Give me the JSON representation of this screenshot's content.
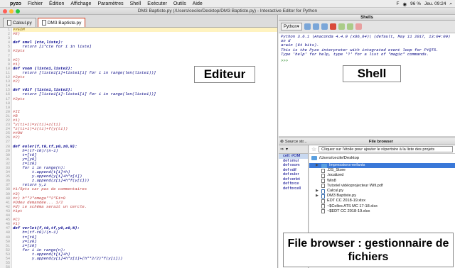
{
  "menubar": {
    "apple_icon": "apple-icon",
    "items": [
      "pyzo",
      "Fichier",
      "Édition",
      "Affichage",
      "Paramètres",
      "Shell",
      "Exécuter",
      "Outils",
      "Aide"
    ],
    "status": {
      "battery": "96 %",
      "datetime": "Jeu. 09:24",
      "keyboard": "F"
    }
  },
  "window": {
    "title": "DM3 Baptiste.py (/Users/cecile/Desktop/DM3 Baptiste.py) - Interactive Editor for Python",
    "colors": {
      "close": "#ff5f57",
      "minimize": "#febc2e",
      "zoom": "#28c840"
    }
  },
  "editor": {
    "tabs": [
      {
        "label": "Calcul.py",
        "active": false
      },
      {
        "label": "DM3 Baptiste.py",
        "active": true
      }
    ],
    "line_numbers": [
      "1",
      "2",
      "3",
      "4",
      "5",
      "6",
      "7",
      "8",
      "9",
      "10",
      "11",
      "12",
      "13",
      "14",
      "15",
      "16",
      "17",
      "18",
      "19",
      "20",
      "21",
      "22",
      "23",
      "24",
      "25",
      "26",
      "27",
      "28",
      "29",
      "30",
      "31",
      "32",
      "33",
      "34",
      "35",
      "36",
      "37",
      "38",
      "39",
      "40",
      "41",
      "42",
      "43",
      "44",
      "45",
      "46",
      "47",
      "48",
      "49",
      "50",
      "51",
      "52",
      "53",
      "54",
      "55",
      "56"
    ],
    "lines": [
      {
        "text": "##EDM",
        "kind": "cell"
      },
      {
        "text": "#E)",
        "kind": "cmt"
      },
      {
        "text": "",
        "kind": "code"
      },
      {
        "text": "def smul (cte,liste):",
        "kind": "def"
      },
      {
        "text": "    return [i*cte for i in liste]",
        "kind": "code"
      },
      {
        "text": "#2pts",
        "kind": "cmt"
      },
      {
        "text": "",
        "kind": "code"
      },
      {
        "text": "#C)",
        "kind": "cmt"
      },
      {
        "text": "#1)",
        "kind": "cmt"
      },
      {
        "text": "def vsom (liste1,liste2):",
        "kind": "def"
      },
      {
        "text": "    return [liste1[i]+liste1[i] for i in range(len(liste1))]",
        "kind": "code"
      },
      {
        "text": "#2pts",
        "kind": "cmt"
      },
      {
        "text": "#2)",
        "kind": "cmt"
      },
      {
        "text": "",
        "kind": "code"
      },
      {
        "text": "def vdif (liste1,liste2):",
        "kind": "def"
      },
      {
        "text": "    return [liste1[i]-liste1[i] for i in range(len(liste1))]",
        "kind": "code"
      },
      {
        "text": "#2pts",
        "kind": "cmt"
      },
      {
        "text": "",
        "kind": "code"
      },
      {
        "text": "",
        "kind": "code"
      },
      {
        "text": "#II",
        "kind": "cmt"
      },
      {
        "text": "#B",
        "kind": "cmt"
      },
      {
        "text": "#1)",
        "kind": "cmt"
      },
      {
        "text": "\"y(ti+1)=y(ti)+z(ti)",
        "kind": "cmt"
      },
      {
        "text": "\"z(ti+1)=z(ti)+f(y(ti))",
        "kind": "cmt"
      },
      {
        "text": "##ON",
        "kind": "cmt"
      },
      {
        "text": "#2)",
        "kind": "cmt"
      },
      {
        "text": "",
        "kind": "code"
      },
      {
        "text": "def euler(f,t0,tf,y0,z0,N):",
        "kind": "def"
      },
      {
        "text": "    h=(tf-t0)/(n-1)",
        "kind": "code"
      },
      {
        "text": "    t=[t0]",
        "kind": "code"
      },
      {
        "text": "    y=[y0]",
        "kind": "code"
      },
      {
        "text": "    z=[z0]",
        "kind": "code"
      },
      {
        "text": "    for i in range(n):",
        "kind": "code"
      },
      {
        "text": "        t.append(t[i]+h)",
        "kind": "code"
      },
      {
        "text": "        y.append(y[i]+h*z[i])",
        "kind": "code"
      },
      {
        "text": "        z.append(z[i]+h*f(y[i]))",
        "kind": "code"
      },
      {
        "text": "    return y,z",
        "kind": "code"
      },
      {
        "text": "#1/5pts car pas de commentaires",
        "kind": "cmt"
      },
      {
        "text": "#3)",
        "kind": "cmt"
      },
      {
        "text": "#c) h**2*omega**2*Ei=0",
        "kind": "cmt"
      },
      {
        "text": "#Odeu demandée... 1/2",
        "kind": "cmt"
      },
      {
        "text": "#d) Le schéma serait un cercle.",
        "kind": "cmt"
      },
      {
        "text": "#1pt",
        "kind": "cmt"
      },
      {
        "text": "",
        "kind": "code"
      },
      {
        "text": "#C)",
        "kind": "cmt"
      },
      {
        "text": "#1)",
        "kind": "cmt"
      },
      {
        "text": "def verlet(f,t0,tf,y0,z0,N):",
        "kind": "def"
      },
      {
        "text": "    h=(tf-t0)/(n-1)",
        "kind": "code"
      },
      {
        "text": "    t=[t0]",
        "kind": "code"
      },
      {
        "text": "    y=[y0]",
        "kind": "code"
      },
      {
        "text": "    z=[z0]",
        "kind": "code"
      },
      {
        "text": "    for i in range(n):",
        "kind": "code"
      },
      {
        "text": "        t.append(t[i]+h)",
        "kind": "code"
      },
      {
        "text": "        y.append(y[i]+h*z[i]+(h**2/2)*f(y[i]))",
        "kind": "code"
      },
      {
        "text": "",
        "kind": "code"
      },
      {
        "text": "",
        "kind": "code"
      }
    ],
    "overlay_label": "Editeur"
  },
  "shell": {
    "pane_title": "Shells",
    "tab_label": "Python",
    "output": [
      "Python 3.6.1 |Anaconda 4.4.0 (x86_64)| (default, May 11 2017, 13:04:09) on d",
      "arwin (64 bits).",
      "This is the Pyzo interpreter with integrated event loop for PYQT5.",
      "Type 'help' for help, type '?' for a list of *magic* commands."
    ],
    "prompt": ">>>",
    "overlay_label": "Shell"
  },
  "source_structure": {
    "title": "Source str...",
    "items": [
      {
        "label": "cell: #OM",
        "selected": true
      },
      {
        "label": "def smul",
        "selected": false
      },
      {
        "label": "def vsom",
        "selected": false
      },
      {
        "label": "def vdif",
        "selected": false
      },
      {
        "label": "def euler",
        "selected": false
      },
      {
        "label": "def verlet",
        "selected": false
      },
      {
        "label": "def force",
        "selected": false
      },
      {
        "label": "def forcell",
        "selected": false
      }
    ]
  },
  "file_browser": {
    "title": "File browser",
    "hint": "Cliquez sur l'étoile pour ajouter le répertoire à la liste des projets",
    "path": "/Users/cecile/Desktop",
    "items": [
      {
        "label": "Impressions-enfants",
        "type": "folder",
        "expandable": true,
        "selected": true
      },
      {
        "label": ".DS_Store",
        "type": "file",
        "expandable": false,
        "selected": false
      },
      {
        "label": ".localized",
        "type": "file",
        "expandable": false,
        "selected": false
      },
      {
        "label": "Win8",
        "type": "file",
        "expandable": false,
        "selected": false
      },
      {
        "label": "Tutoriel vidéoprojecteur Wifi.pdf",
        "type": "file",
        "expandable": false,
        "selected": false
      },
      {
        "label": "Calcul.py",
        "type": "py",
        "expandable": true,
        "selected": false
      },
      {
        "label": "DM3 Baptiste.py",
        "type": "py",
        "expandable": true,
        "selected": false
      },
      {
        "label": "EDT CC 2018-19.xlsx",
        "type": "file",
        "expandable": false,
        "selected": false
      },
      {
        "label": "~$Colles ATS MC 17-18.xlsx",
        "type": "file",
        "expandable": false,
        "selected": false
      },
      {
        "label": "~$EDT CC 2018-19.xlsx",
        "type": "file",
        "expandable": false,
        "selected": false
      }
    ],
    "overlay_label": "File browser : gestionnaire de fichiers"
  }
}
